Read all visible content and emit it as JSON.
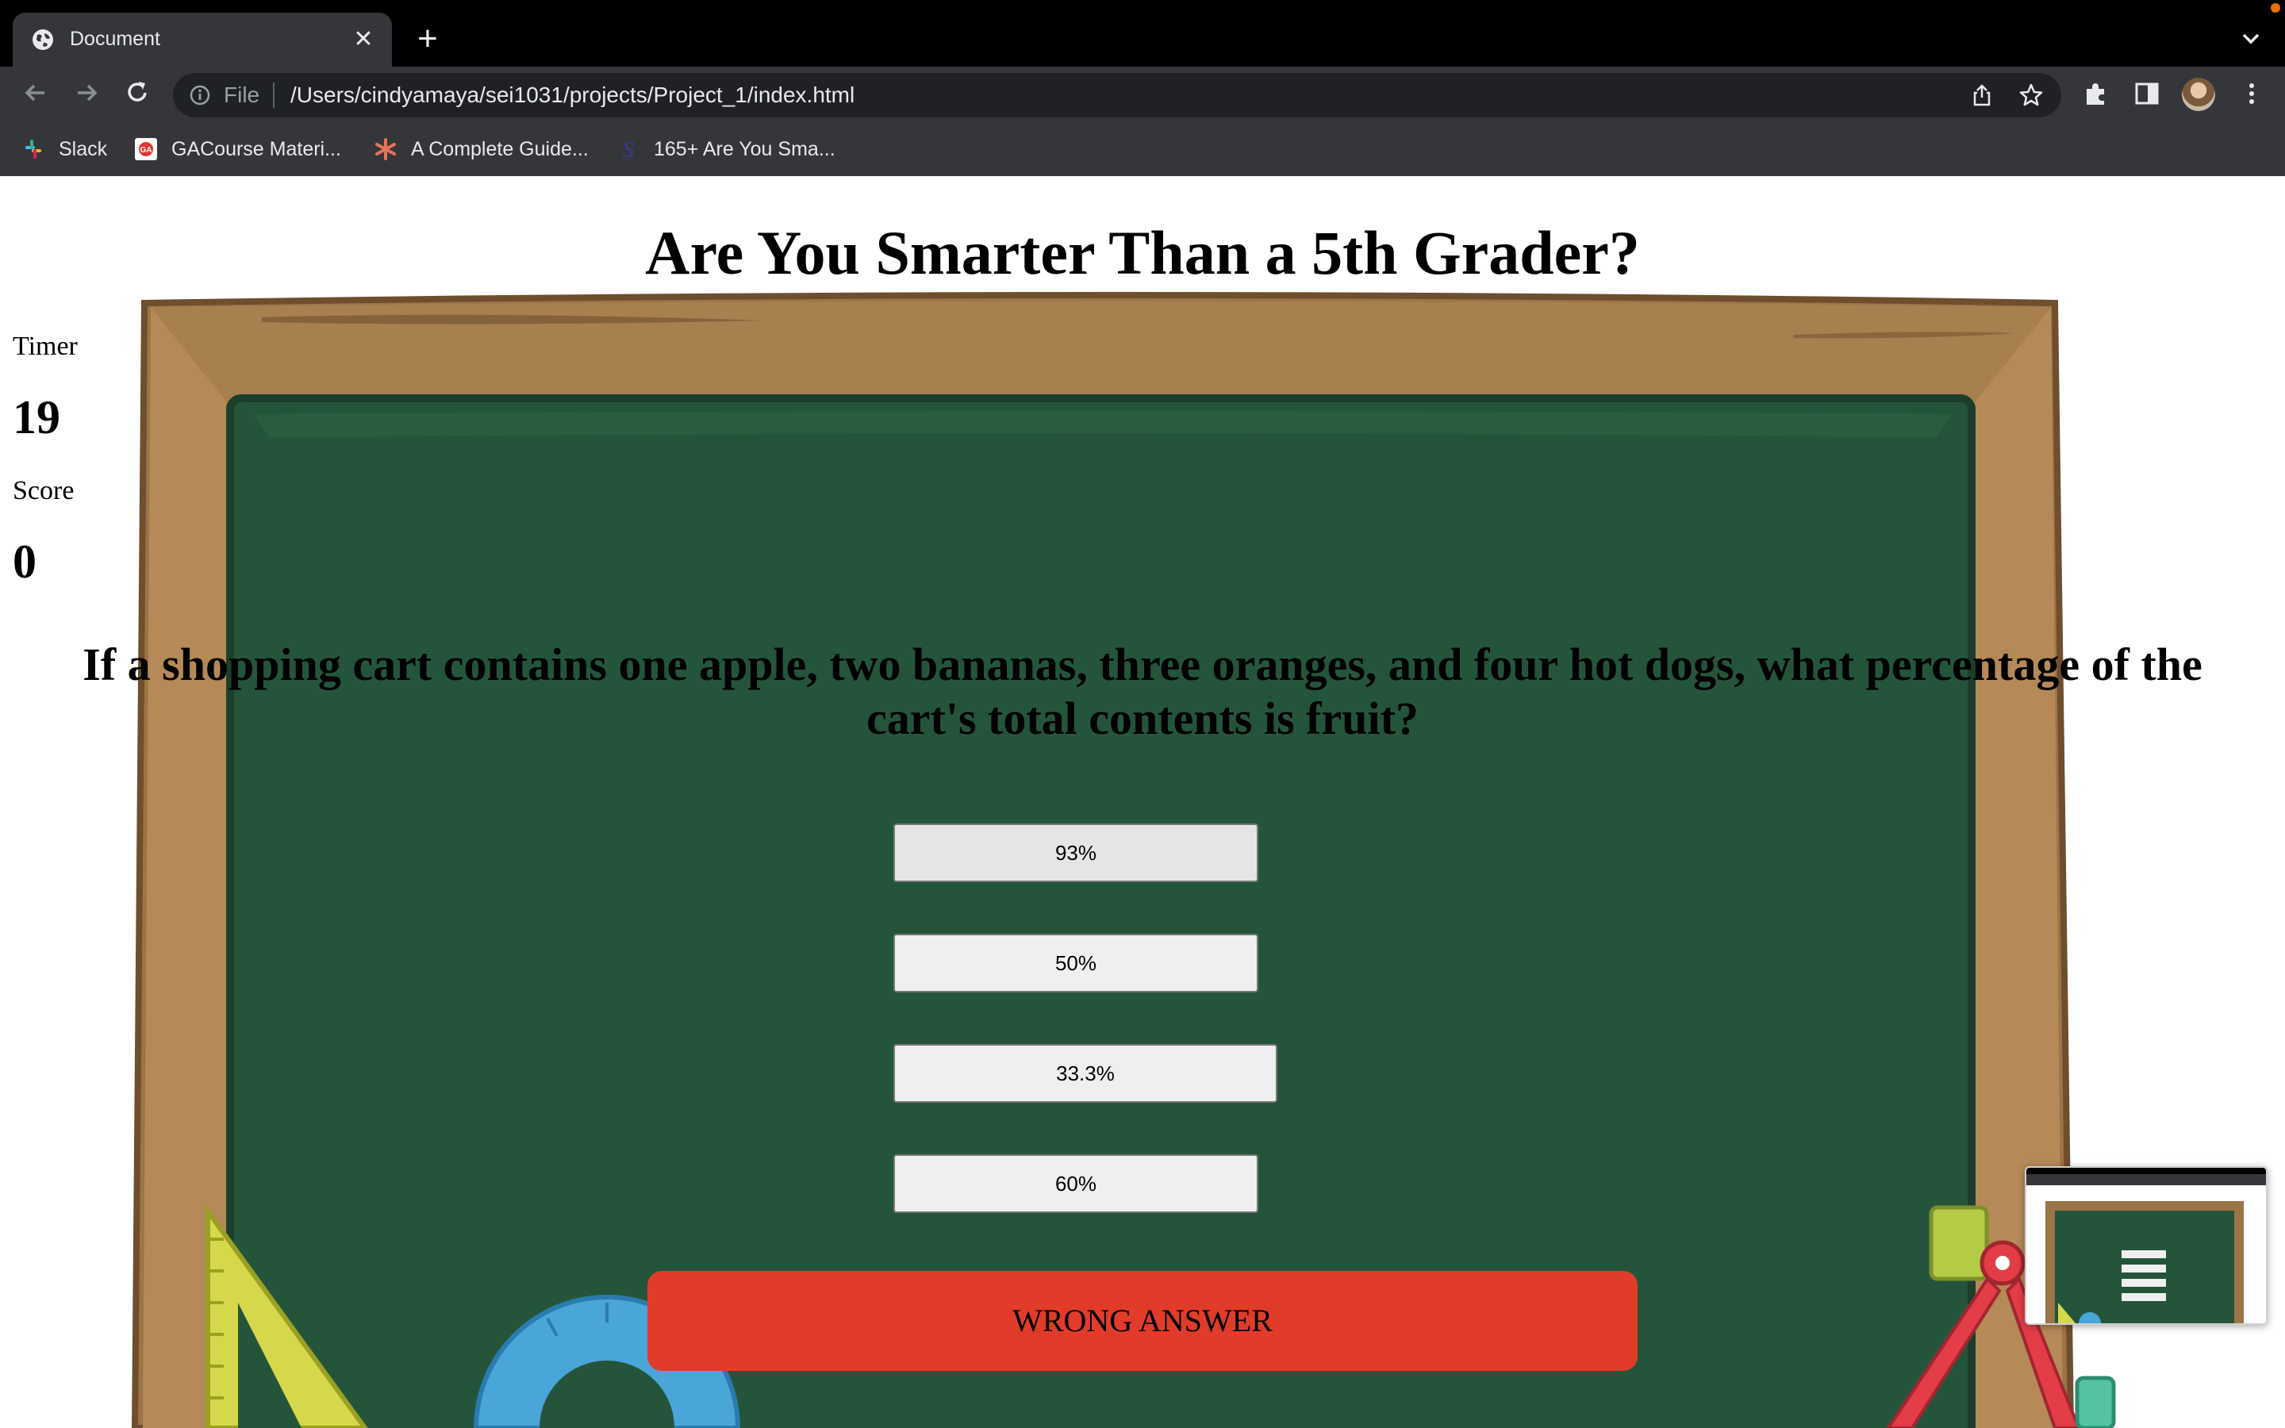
{
  "browser": {
    "tab_title": "Document",
    "omnibox_scheme": "File",
    "url": "/Users/cindyamaya/sei1031/projects/Project_1/index.html",
    "bookmarks": [
      {
        "label": "Slack",
        "icon": "slack-icon"
      },
      {
        "label": "GACourse Materi...",
        "icon": "ga-icon"
      },
      {
        "label": "A Complete Guide...",
        "icon": "asterisk-icon"
      },
      {
        "label": "165+ Are You Sma...",
        "icon": "s-logo-icon"
      }
    ]
  },
  "game": {
    "title": "Are You Smarter Than a 5th Grader?",
    "timer_label": "Timer",
    "timer_value": "19",
    "score_label": "Score",
    "score_value": "0",
    "question": "If a shopping cart contains one apple, two bananas, three oranges, and four hot dogs, what percentage of the cart's total contents is fruit?",
    "answers": [
      "93%",
      "50%",
      "33.3%",
      "60%"
    ],
    "result": "WRONG ANSWER"
  },
  "colors": {
    "chalkboard": "#24553a",
    "frame": "#9b7448",
    "result_bar": "#e03c29"
  }
}
